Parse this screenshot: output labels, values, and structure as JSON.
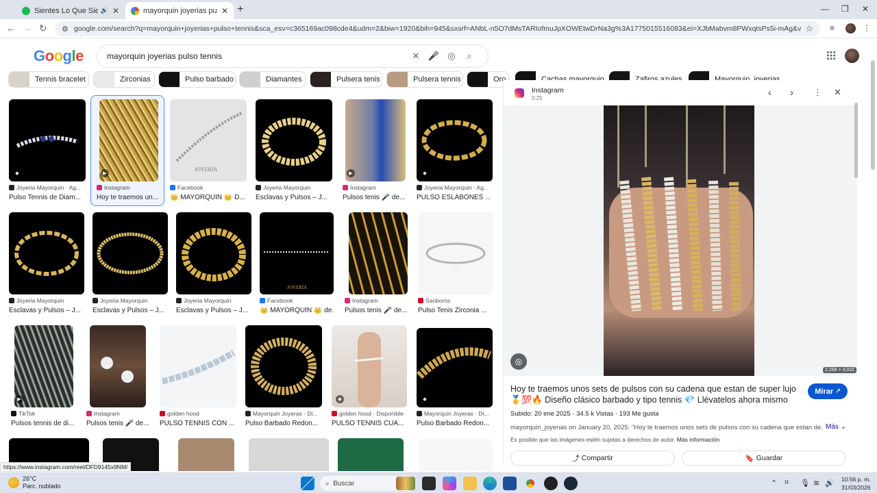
{
  "browser": {
    "tabs": [
      {
        "title": "Sientes Lo Que Siento - Vo",
        "favicon_color": "#1db954"
      },
      {
        "title": "mayorquin joyerias pulso tenni",
        "favicon_color": "#4285f4"
      }
    ],
    "url": "google.com/search?q=mayorquin+joyerias+pulso+tennis&sca_esv=c365169ac098cde4&udm=2&biw=1920&bih=945&sxsrf=ANbL-n5O7dMsTARIofmuJpXOWEtwDrNa3g%3A1775015516083&ei=XJbMabvm8PWxqtsPs5i-mAg&ved=0ahUKEwi7hLqK4MuTA..."
  },
  "google": {
    "logo": [
      "G",
      "o",
      "o",
      "g",
      "l",
      "e"
    ],
    "logo_colors": [
      "#4285f4",
      "#ea4335",
      "#fbbc05",
      "#4285f4",
      "#34a853",
      "#ea4335"
    ],
    "query": "mayorquin joyerias pulso tennis"
  },
  "chips": [
    {
      "label": "Tennis bracelet",
      "thumb": "#d8d2c8"
    },
    {
      "label": "Zirconias",
      "thumb": "#e9e9e9"
    },
    {
      "label": "Pulso barbado",
      "thumb": "#111111"
    },
    {
      "label": "Diamantes",
      "thumb": "#cfcfcf"
    },
    {
      "label": "Pulsera tenis",
      "thumb": "#2a2220"
    },
    {
      "label": "Pulsera tennis",
      "thumb": "#b89a80"
    },
    {
      "label": "Oro",
      "thumb": "#111111"
    },
    {
      "label": "Cachas mayorquin",
      "thumb": "#111111"
    },
    {
      "label": "Zafiros azules",
      "thumb": "#151515"
    },
    {
      "label": "Mayorquin_joyerias",
      "thumb": "#141414"
    }
  ],
  "results": [
    {
      "source": "Joyeria Mayorquin · Ag...",
      "title": "Pulso Tennis de Diam...",
      "source_color": "#222222",
      "style": "dark"
    },
    {
      "source": "Instagram",
      "title": "Hoy te traemos un...",
      "source_color": "#d62976",
      "style": "gold"
    },
    {
      "source": "Facebook",
      "title": "👑 MAYORQUIN 👑 D...",
      "source_color": "#1877f2",
      "style": "light"
    },
    {
      "source": "Joyeria Mayorquin",
      "title": "Esclavas y Pulsos – J...",
      "source_color": "#222222",
      "style": "dark"
    },
    {
      "source": "Instagram",
      "title": "Pulsos tenis 🎤 de...",
      "source_color": "#d62976",
      "style": "gold"
    },
    {
      "source": "Joyeria Mayorquin · Ag...",
      "title": "PULSO ESLABONES ...",
      "source_color": "#222222",
      "style": "dark"
    },
    {
      "source": "Joyeria Mayorquin",
      "title": "Esclavas y Pulsos – J...",
      "source_color": "#222222",
      "style": "dark"
    },
    {
      "source": "Joyeria Mayorquin",
      "title": "Esclavas y Pulsos – J...",
      "source_color": "#222222",
      "style": "dark"
    },
    {
      "source": "Joyeria Mayorquin",
      "title": "Esclavas y Pulsos – J...",
      "source_color": "#222222",
      "style": "dark"
    },
    {
      "source": "Facebook",
      "title": "👑 MAYORQUIN 👑 de...",
      "source_color": "#1877f2",
      "style": "dark"
    },
    {
      "source": "Instagram",
      "title": "Pulsos tenis 🎤 de...",
      "source_color": "#d62976",
      "style": "gold"
    },
    {
      "source": "Sanborns",
      "title": "Pulso Tenis Zirconia ...",
      "source_color": "#c8102e",
      "style": "light"
    },
    {
      "source": "TikTok",
      "title": "Pulsos tennis de di...",
      "source_color": "#111111",
      "style": "gold"
    },
    {
      "source": "Instagram",
      "title": "Pulsos tenis 🎤 de...",
      "source_color": "#d62976",
      "style": "gold"
    },
    {
      "source": "golden hood",
      "title": "PULSO TENNIS CON ...",
      "source_color": "#c8102e",
      "style": "light"
    },
    {
      "source": "Mayorquin Joyeras · Di...",
      "title": "Pulso Barbado Redon...",
      "source_color": "#222222",
      "style": "dark"
    },
    {
      "source": "golden hood · Disponible",
      "title": "PULSO TENNIS CUA...",
      "source_color": "#c8102e",
      "style": "light"
    },
    {
      "source": "Mayorquin Joyeras · Di...",
      "title": "Pulso Barbado Redon...",
      "source_color": "#222222",
      "style": "dark"
    }
  ],
  "panel": {
    "source": "Instagram",
    "time": "0:25",
    "dimensions": "2,268 × 4,032",
    "caption": "Hoy te traemos unos sets de pulsos con su cadena que estan de super lujo 🥇💯🔥 Diseño clásico barbado y tipo tennis 💎 Llévatelos ahora mismo y...",
    "mirar": "Mirar",
    "stats": "Subido: 20 ene 2025 · 34.5 k Vistas · 193 Me gusta",
    "description": "mayorquin_joyenas on January 20, 2025: \"Hoy te traemos unos sets de pulsos con su cadena que estan de...",
    "mas": "Más",
    "rights": "Es posible que las imágenes estén sujetas a derechos de autor.",
    "rights_link": "Más información",
    "share": "Compartir",
    "save": "Guardar"
  },
  "status_link": "https://www.instagram.com/reel/DFD9145x9NM/",
  "taskbar": {
    "temp": "26°C",
    "condition": "Parc. nublado",
    "search": "Buscar",
    "time": "10:56 p. m.",
    "date": "31/03/2026"
  }
}
